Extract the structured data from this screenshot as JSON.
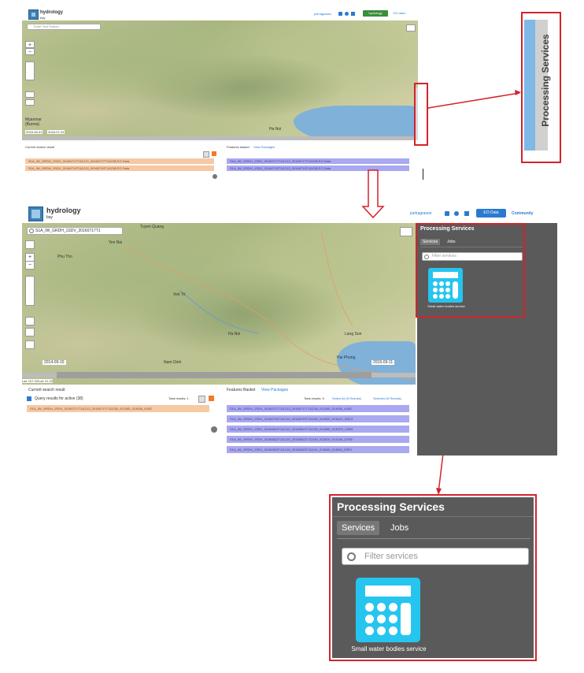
{
  "app": {
    "title": "hydrology",
    "subtitle": "bay"
  },
  "header": {
    "top_user": "joehagrasen",
    "top_button": "hydrology",
    "top_menu": "EO data",
    "bottom_user": "joehagrasen",
    "bottom_button": "EO Data",
    "bottom_community": "Community"
  },
  "map": {
    "search_placeholder_top": "Enter Text Search",
    "search_value_bottom": "S1A_IW_GRDH_1SDV_20160717T1",
    "labels": {
      "yen_bai": "Yen Bai",
      "tuyen_quang": "Tuyen Quang",
      "ha_noi": "Ha Noi",
      "hai_phong": "Hai Phong",
      "nam_dinh": "Nam Dinh",
      "phu_tho": "Phu Tho",
      "viet_tri": "Viet Tri",
      "lang_son": "Lang Son",
      "ha_noi_top": "Ha Noi",
      "myanmar": "Myanmar (Burma)"
    },
    "dates_top": [
      "2015-05-31",
      "2016-07-24"
    ],
    "dates_bottom": [
      "2014-09-15",
      "2016-09-11"
    ],
    "coords_bottom": "Lat: 107.22/Lat: 21.22",
    "processing_tab_label": "Processing Services"
  },
  "results_top": {
    "title": "Current search result",
    "features_title": "Features basket",
    "view_packages": "View Packages",
    "orange_rows": [
      "S1A_IW_GRDH_1SDV_20160717T111213_20160717T111238 EO Data",
      "S1A_IW_GRDH_1SDV_20160719T111213_20160719T111238 EO Data"
    ],
    "purple_rows": [
      "S1A_IW_GRDH_1SDV_20160717T111213_20160717T111238 EO Data",
      "S1A_IW_GRDH_1SDV_20160719T111213_20160719T111238 EO Data"
    ]
  },
  "results_bottom": {
    "title": "Current search result",
    "query_label": "Query results for active (38)",
    "total_results": "Total results: 1",
    "features_title": "Features Basket",
    "view_packages": "View Packages",
    "total_results_right": "Total results: 5",
    "select_all": "Select All (3 Results)",
    "selected_label": "Selected (5 Results)",
    "orange_rows": [
      "S1A_IW_GRDH_1SDV_20160717T111213_20160717T111238_012345_013456_A1B2"
    ],
    "purple_rows": [
      "S1A_IW_GRDH_1SDV_20160717T111213_20160717T111238_012345_013456_A1B2",
      "S1A_IW_GRDH_1SDV_20160729T111214_20160729T111239_012520_013A1C_B3C4",
      "S1A_IW_GRDH_1SDV_20160810T111214_20160810T111239_012695_013DE2_C5D6",
      "S1A_IW_GRDH_1SDV_20160822T111215_20160822T111240_012870_0141A5_D7E8",
      "S1A_IW_GRDH_1SDV_20160903T111216_20160903T111241_013045_014564_E9F0"
    ]
  },
  "panel": {
    "title": "Processing Services",
    "tab_services": "Services",
    "tab_jobs": "Jobs",
    "filter_placeholder": "Filter services",
    "service_name": "Small water bodies service"
  },
  "callout_right": {
    "label": "Processing Services"
  },
  "colors": {
    "accent": "#2a7bd0",
    "highlight": "#d2232a",
    "panel_bg": "#5a5a5a",
    "service_icon": "#25c5ef",
    "green_button": "#3a8f3a"
  }
}
